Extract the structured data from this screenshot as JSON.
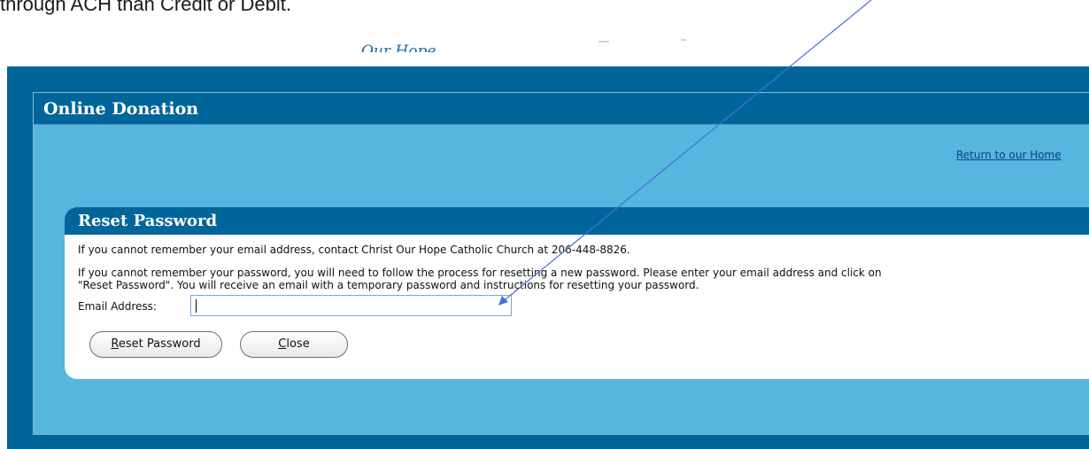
{
  "doc_caption": "through ACH than Credit or Debit.",
  "logo_text": "Our Hope",
  "page": {
    "title": "Online Donation",
    "home_link": "Return to our Home"
  },
  "reset_panel": {
    "title": "Reset Password",
    "contact_text": "If you cannot remember your email address, contact Christ Our Hope Catholic Church at 206-448-8826.",
    "instructions_line1": "If you cannot remember your password, you will need to follow the process for resetting a new password. Please enter your email address and click on",
    "instructions_line2": "\"Reset Password\". You will receive an email with a temporary password and instructions for resetting your password.",
    "email_label": "Email Address:",
    "email_value": "",
    "reset_button": {
      "accel": "R",
      "rest": "eset Password"
    },
    "close_button": {
      "accel": "C",
      "rest": "lose"
    }
  },
  "colors": {
    "frame_blue": "#006699",
    "content_blue": "#56b6de",
    "link": "#0d3c8c",
    "annotation_arrow": "#4a6fd6"
  }
}
